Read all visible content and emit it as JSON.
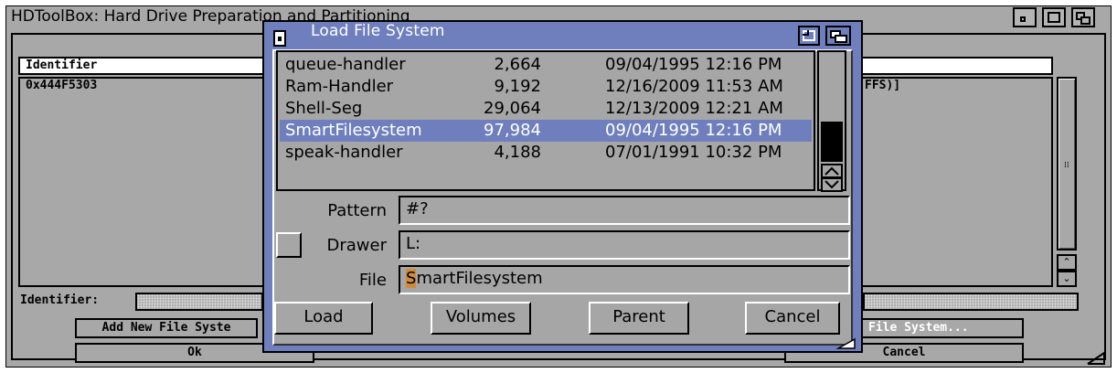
{
  "main_window": {
    "title": "HDToolBox: Hard Drive Preparation and Partitioning",
    "list_header": "Identifier",
    "list_rows": [
      {
        "identifier": "0x444F5303",
        "trailing": "FFS)]"
      }
    ],
    "identifier_label": "Identifier:",
    "buttons": {
      "add_new": "Add New File Syste",
      "update": "File System...",
      "ok": "Ok",
      "cancel": "Cancel"
    }
  },
  "dialog": {
    "title": "Load File System",
    "files": [
      {
        "name": "queue-handler",
        "size": "2,664",
        "date": "09/04/1995 12:16 PM",
        "selected": false
      },
      {
        "name": "Ram-Handler",
        "size": "9,192",
        "date": "12/16/2009 11:53 AM",
        "selected": false
      },
      {
        "name": "Shell-Seg",
        "size": "29,064",
        "date": "12/13/2009 12:21 AM",
        "selected": false
      },
      {
        "name": "SmartFilesystem",
        "size": "97,984",
        "date": "09/04/1995 12:16 PM",
        "selected": true
      },
      {
        "name": "speak-handler",
        "size": "4,188",
        "date": "07/01/1991 10:32 PM",
        "selected": false
      }
    ],
    "pattern_label": "Pattern",
    "pattern_value": "#?",
    "drawer_label": "Drawer",
    "drawer_value": "L:",
    "file_label": "File",
    "file_value_first": "S",
    "file_value_rest": "martFilesystem",
    "buttons": {
      "load": "Load",
      "volumes": "Volumes",
      "parent": "Parent",
      "cancel": "Cancel"
    }
  },
  "icons": [
    "close-icon",
    "zoom-icon",
    "depth-icon",
    "resize-icon",
    "scroll-up-icon",
    "scroll-down-icon"
  ],
  "colors": {
    "window_bg": "#a8a8a8",
    "title_blue": "#6f7fbe",
    "selection": "#6f7fbe",
    "cursor": "#d08a3c"
  }
}
